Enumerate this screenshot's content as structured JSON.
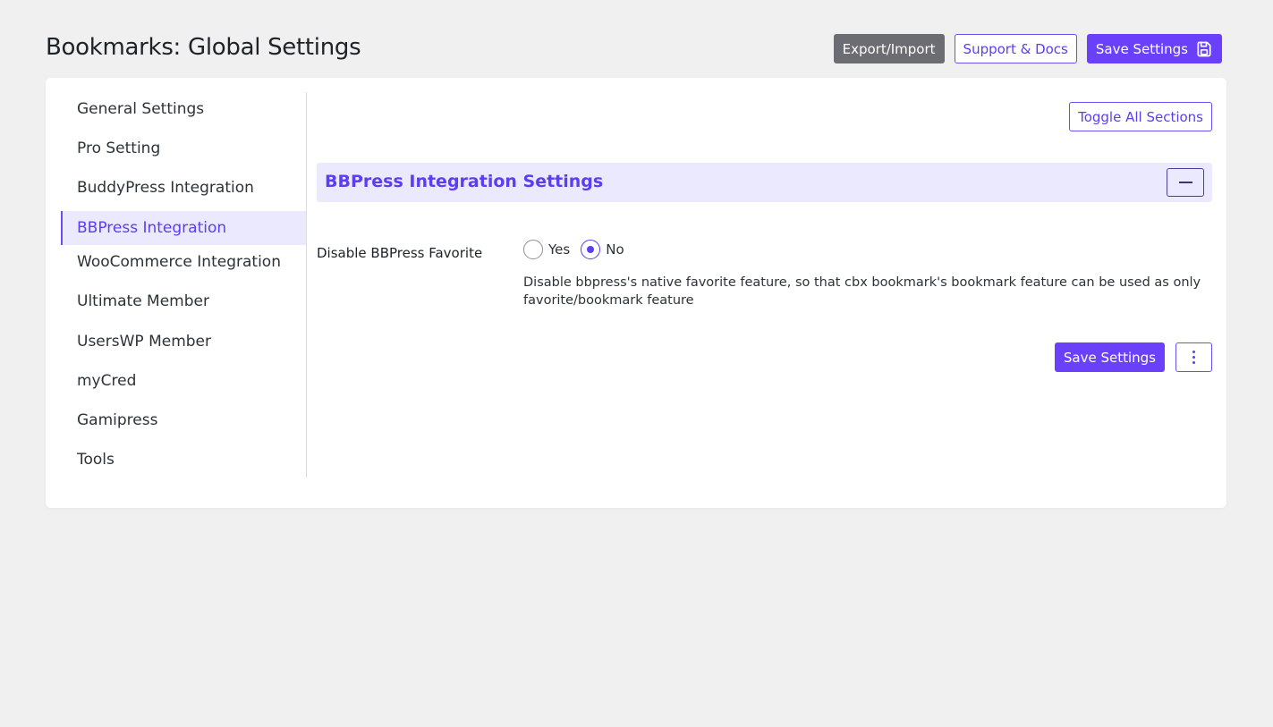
{
  "page": {
    "title": "Bookmarks: Global Settings"
  },
  "header_actions": {
    "export_import": "Export/Import",
    "support_docs": "Support & Docs",
    "save_settings": "Save Settings",
    "save_icon": "floppy-disk-icon"
  },
  "sidebar": {
    "items": [
      {
        "label": "General Settings",
        "active": false
      },
      {
        "label": "Pro Setting",
        "active": false
      },
      {
        "label": "BuddyPress Integration",
        "active": false
      },
      {
        "label": "BBPress Integration",
        "active": true
      },
      {
        "label": "WooCommerce Integration",
        "active": false
      },
      {
        "label": "Ultimate Member",
        "active": false
      },
      {
        "label": "UsersWP Member",
        "active": false
      },
      {
        "label": "myCred",
        "active": false
      },
      {
        "label": "Gamipress",
        "active": false
      },
      {
        "label": "Tools",
        "active": false
      }
    ]
  },
  "main": {
    "toggle_all": "Toggle All Sections",
    "section": {
      "title": "BBPress Integration Settings",
      "collapse_icon": "minus-icon"
    },
    "field": {
      "label": "Disable BBPress Favorite",
      "options": [
        {
          "label": "Yes",
          "checked": false
        },
        {
          "label": "No",
          "checked": true
        }
      ],
      "description": "Disable bbpress's native favorite feature, so that cbx bookmark's bookmark feature can be used as only favorite/bookmark feature"
    },
    "footer": {
      "save_settings": "Save Settings",
      "more_icon": "kebab-menu-icon"
    }
  },
  "colors": {
    "accent": "#6a40fb",
    "accent_light": "#ebe9fd",
    "gray_button": "#6c6c73",
    "background": "#f0f0f1"
  }
}
